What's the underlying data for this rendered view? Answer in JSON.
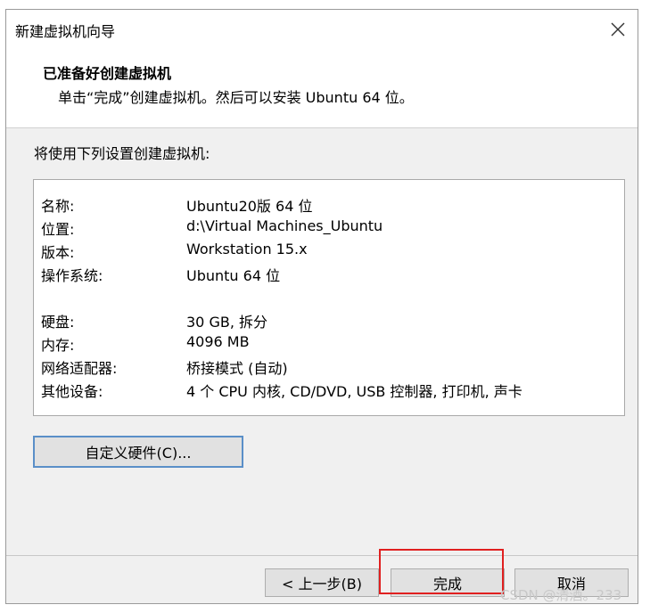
{
  "window": {
    "title": "新建虚拟机向导"
  },
  "header": {
    "title": "已准备好创建虚拟机",
    "subtitle": "单击“完成”创建虚拟机。然后可以安装 Ubuntu 64 位。"
  },
  "intro": "将使用下列设置创建虚拟机:",
  "summary": {
    "rows": [
      {
        "label": "名称:",
        "value": "Ubuntu20版 64 位"
      },
      {
        "label": "位置:",
        "value": "d:\\Virtual Machines_Ubuntu"
      },
      {
        "label": "版本:",
        "value": "Workstation 15.x"
      },
      {
        "label": "操作系统:",
        "value": "Ubuntu 64 位"
      },
      {
        "label": "硬盘:",
        "value": "30 GB, 拆分"
      },
      {
        "label": "内存:",
        "value": "4096 MB"
      },
      {
        "label": "网络适配器:",
        "value": "桥接模式 (自动)"
      },
      {
        "label": "其他设备:",
        "value": "4 个 CPU 内核, CD/DVD, USB 控制器, 打印机, 声卡"
      }
    ]
  },
  "buttons": {
    "customize": "自定义硬件(C)...",
    "back": "< 上一步(B)",
    "finish": "完成",
    "cancel": "取消"
  },
  "watermark": "CSDN @清酒。233",
  "colors": {
    "highlight": "#e02020",
    "focus_border": "#5a8fc8"
  }
}
